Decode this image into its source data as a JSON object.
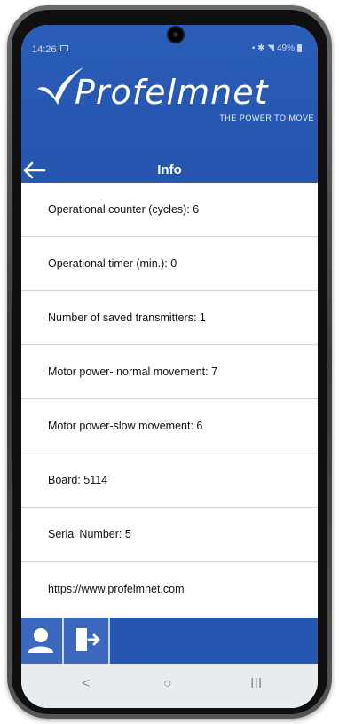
{
  "status": {
    "time": "14:26",
    "battery": "49%"
  },
  "brand": {
    "name": "Profelmnet",
    "tagline": "THE POWER TO MOVE"
  },
  "header": {
    "title": "Info"
  },
  "info_rows": [
    {
      "text": "Operational counter (cycles): 6"
    },
    {
      "text": "Operational timer (min.): 0"
    },
    {
      "text": "Number of saved transmitters: 1"
    },
    {
      "text": "Motor power- normal movement: 7"
    },
    {
      "text": "Motor power-slow  movement: 6"
    },
    {
      "text": "Board: 5114"
    },
    {
      "text": "Serial Number: 5"
    },
    {
      "text": "https://www.profelmnet.com"
    }
  ],
  "nav": {
    "recents": "III",
    "home": "○",
    "back": "<"
  }
}
